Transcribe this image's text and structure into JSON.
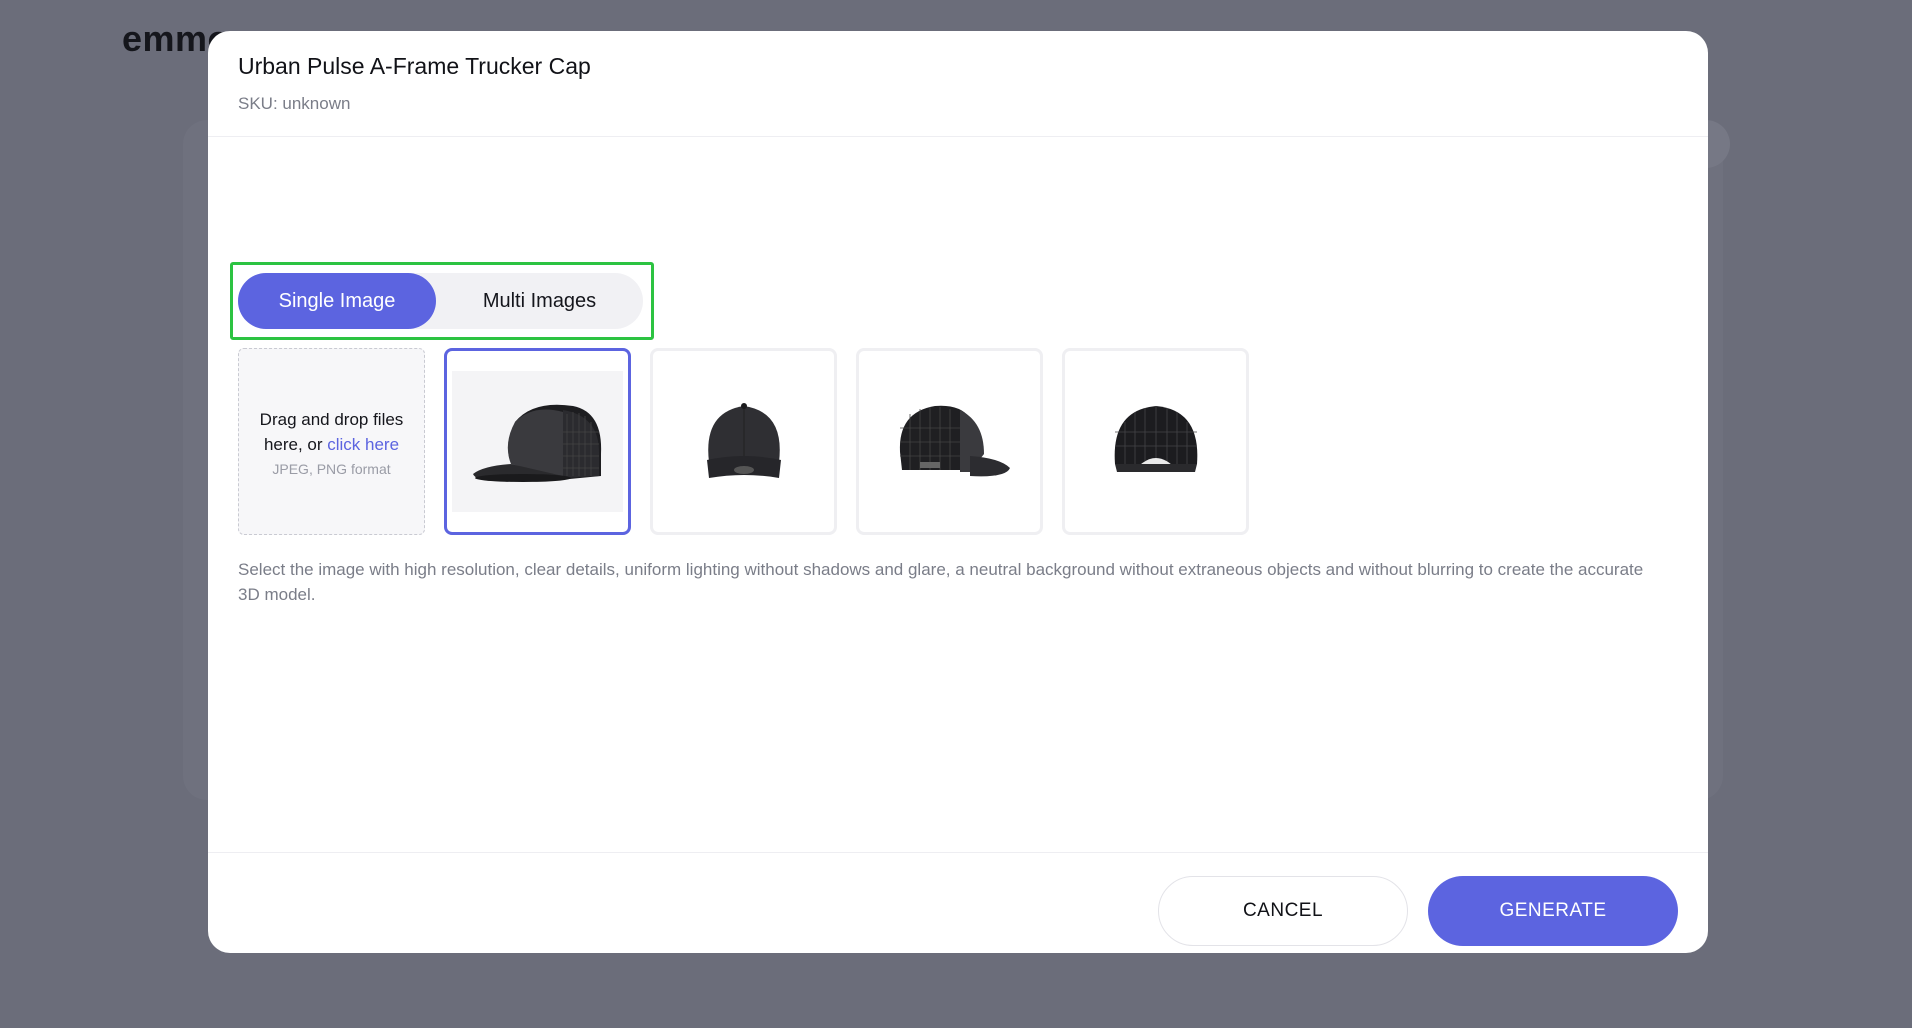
{
  "background": {
    "logo_text": "emmo"
  },
  "modal": {
    "title": "Urban Pulse A-Frame Trucker Cap",
    "sku": "SKU: unknown",
    "tabs": [
      {
        "label": "Single Image",
        "active": true
      },
      {
        "label": "Multi Images",
        "active": false
      }
    ],
    "dropzone": {
      "line1": "Drag and drop files",
      "line2_prefix": "here, or ",
      "link": "click here",
      "format": "JPEG, PNG format"
    },
    "images": [
      {
        "name": "cap-side-left",
        "selected": true
      },
      {
        "name": "cap-front",
        "selected": false
      },
      {
        "name": "cap-side-right",
        "selected": false
      },
      {
        "name": "cap-back",
        "selected": false
      }
    ],
    "hint": "Select the image with high resolution, clear details, uniform lighting without shadows and glare, a neutral background without extraneous objects and without blurring to create the accurate 3D model.",
    "buttons": {
      "cancel": "CANCEL",
      "generate": "GENERATE"
    }
  },
  "colors": {
    "accent": "#5c64e0",
    "highlight": "#2cc341",
    "overlay": "#6b6d7a"
  }
}
